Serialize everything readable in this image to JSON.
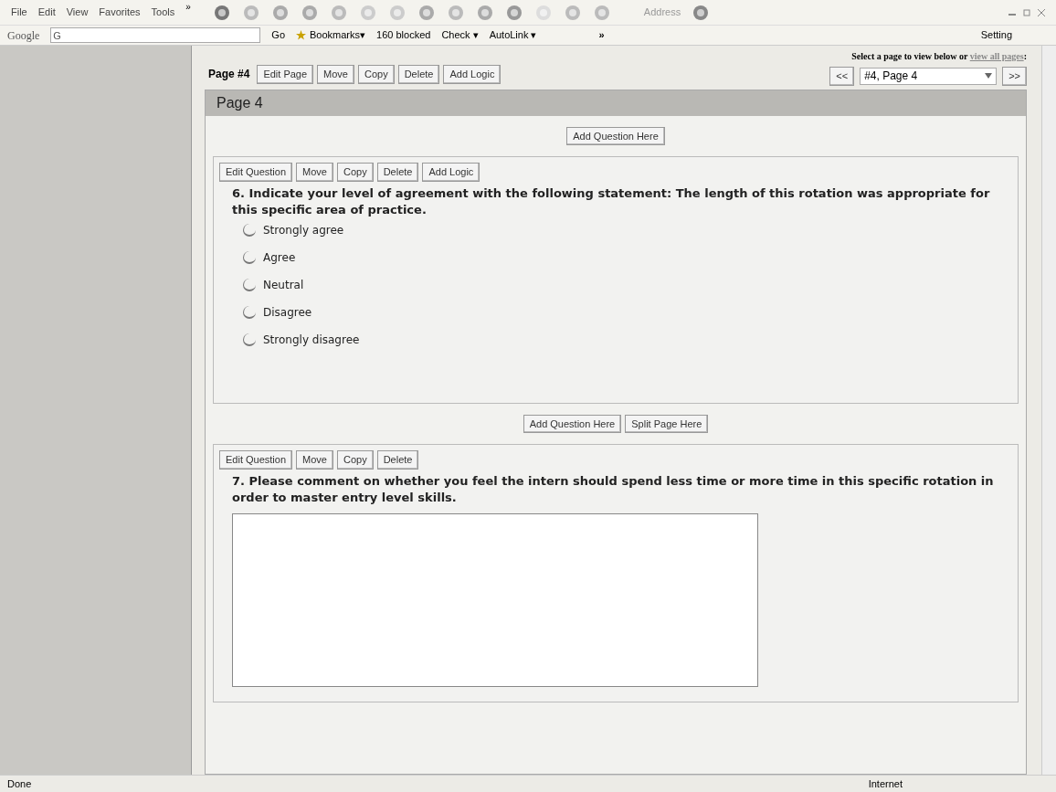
{
  "menu_bar": {
    "items": [
      "File",
      "Edit",
      "View",
      "Favorites",
      "Tools"
    ],
    "overflow": "»",
    "address_label": "Address"
  },
  "google_bar": {
    "brand": "Google",
    "search_prefix": "G",
    "go": "Go",
    "bookmarks": "Bookmarks▾",
    "blocked": "160 blocked",
    "check": "Check ▾",
    "autolink": "AutoLink ▾",
    "overflow": "»",
    "settings": "Setting"
  },
  "page_nav": {
    "label": "Page #4",
    "buttons": [
      "Edit Page",
      "Move",
      "Copy",
      "Delete",
      "Add Logic"
    ],
    "hint": "Select a page to view below or ",
    "hint_link": "view all pages",
    "hint_end": ":",
    "prev": "<<",
    "select_value": "#4, Page 4",
    "next": ">>"
  },
  "page_title": "Page 4",
  "add_question_top": "Add Question Here",
  "questions": [
    {
      "kind": "radio",
      "buttons": [
        "Edit Question",
        "Move",
        "Copy",
        "Delete",
        "Add Logic"
      ],
      "number": "6.",
      "text": "Indicate your level of agreement with the following statement: The length of this rotation was appropriate for this specific area of practice.",
      "options": [
        {
          "label": "Strongly agree",
          "selected": false
        },
        {
          "label": "Agree",
          "selected": false
        },
        {
          "label": "Neutral",
          "selected": false
        },
        {
          "label": "Disagree",
          "selected": false
        },
        {
          "label": "Strongly disagree",
          "selected": false
        }
      ]
    },
    {
      "kind": "comment",
      "buttons": [
        "Edit Question",
        "Move",
        "Copy",
        "Delete"
      ],
      "number": "7.",
      "text": "Please comment on whether you feel the intern should spend less time or more time in this specific rotation in order to master entry level skills."
    }
  ],
  "between_buttons": [
    "Add Question Here",
    "Split Page Here"
  ],
  "status_bar": {
    "status": "Done",
    "zone": "Internet"
  }
}
